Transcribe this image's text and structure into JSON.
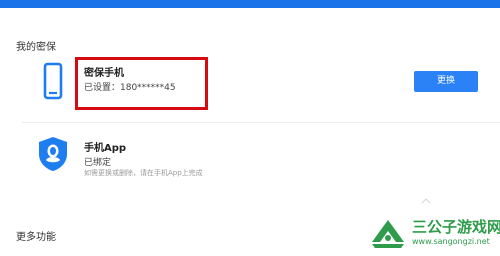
{
  "colors": {
    "accent": "#1a73e8",
    "button": "#2b82f6",
    "highlight_box": "#d60b12",
    "watermark": "#2e9c4a"
  },
  "section_title": "我的密保",
  "phone": {
    "icon": "mobile-phone-icon",
    "title": "密保手机",
    "status": "已设置：180******45",
    "button_label": "更换"
  },
  "app": {
    "icon": "qq-shield-icon",
    "title": "手机App",
    "status": "已绑定",
    "hint": "如需更换或删除，请在手机App上完成"
  },
  "more_section_title": "更多功能",
  "watermark": {
    "name": "三公子游戏网",
    "url": "www.sangongzi.net"
  }
}
